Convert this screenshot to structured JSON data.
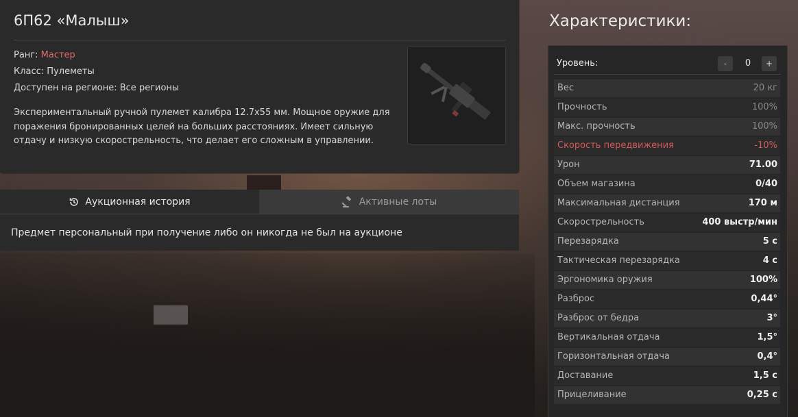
{
  "item": {
    "title": "6П62 «Малыш»",
    "rank_label": "Ранг:",
    "rank_value": "Мастер",
    "class_line": "Класс: Пулеметы",
    "region_line": "Доступен на регионе: Все регионы",
    "description": "Экспериментальный ручной пулемет калибра 12.7x55 мм. Мощное оружие для поражения бронированных целей на больших расстояниях. Имеет сильную отдачу и низкую скорострельность, что делает его сложным в управлении."
  },
  "auction": {
    "tabs": [
      {
        "label": "Аукционная история",
        "icon": "history-icon"
      },
      {
        "label": "Активные лоты",
        "icon": "gavel-icon"
      }
    ],
    "message": "Предмет персональный при получение либо он никогда не был на аукционе"
  },
  "stats": {
    "title": "Характеристики:",
    "level_label": "Уровень:",
    "level_value": "0",
    "minus_label": "-",
    "plus_label": "+",
    "rows": [
      {
        "label": "Вес",
        "value": "20 кг"
      },
      {
        "label": "Прочность",
        "value": "100%"
      },
      {
        "label": "Макс. прочность",
        "value": "100%"
      },
      {
        "label": "Скорость передвижения",
        "value": "-10%"
      },
      {
        "label": "Урон",
        "value": "71.00"
      },
      {
        "label": "Объем магазина",
        "value": "0/40"
      },
      {
        "label": "Максимальная дистанция",
        "value": "170 м"
      },
      {
        "label": "Скорострельность",
        "value": "400 выстр/мин"
      },
      {
        "label": "Перезарядка",
        "value": "5 с"
      },
      {
        "label": "Тактическая перезарядка",
        "value": "4 с"
      },
      {
        "label": "Эргономика оружия",
        "value": "100%"
      },
      {
        "label": "Разброс",
        "value": "0,44°"
      },
      {
        "label": "Разброс от бедра",
        "value": "3°"
      },
      {
        "label": "Вертикальная отдача",
        "value": "1,5°"
      },
      {
        "label": "Горизонтальная отдача",
        "value": "0,4°"
      },
      {
        "label": "Доставание",
        "value": "1,5 с"
      },
      {
        "label": "Прицеливание",
        "value": "0,25 с"
      }
    ]
  },
  "colors": {
    "rank_color": "#e06a6a",
    "negative_stat_color": "#d65a5a"
  }
}
